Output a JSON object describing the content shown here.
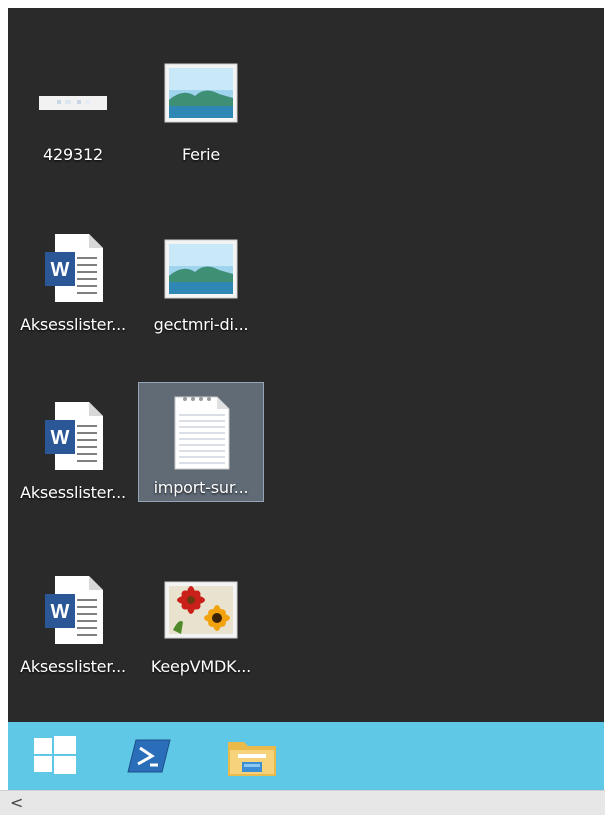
{
  "desktop": {
    "icons": [
      {
        "label": "429312",
        "type": "thumbnail-icon"
      },
      {
        "label": "Ferie",
        "type": "image-file-icon"
      },
      {
        "label": "Aksesslister...",
        "type": "word-document-icon"
      },
      {
        "label": "gectmri-di...",
        "type": "image-file-icon"
      },
      {
        "label": "Aksesslister...",
        "type": "word-document-icon"
      },
      {
        "label": "import-sur...",
        "type": "text-file-icon"
      },
      {
        "label": "Aksesslister...",
        "type": "word-document-icon"
      },
      {
        "label": "KeepVMDK...",
        "type": "flower-image-icon"
      }
    ]
  },
  "taskbar": {
    "buttons": [
      {
        "name": "windows-start-icon"
      },
      {
        "name": "powershell-icon"
      },
      {
        "name": "file-explorer-icon"
      }
    ],
    "color": "#5ec8e6"
  },
  "scrollbar": {
    "left_arrow": "<"
  },
  "colors": {
    "desktop_bg": "#2a2a2a",
    "selection": "#8ca0b4"
  }
}
